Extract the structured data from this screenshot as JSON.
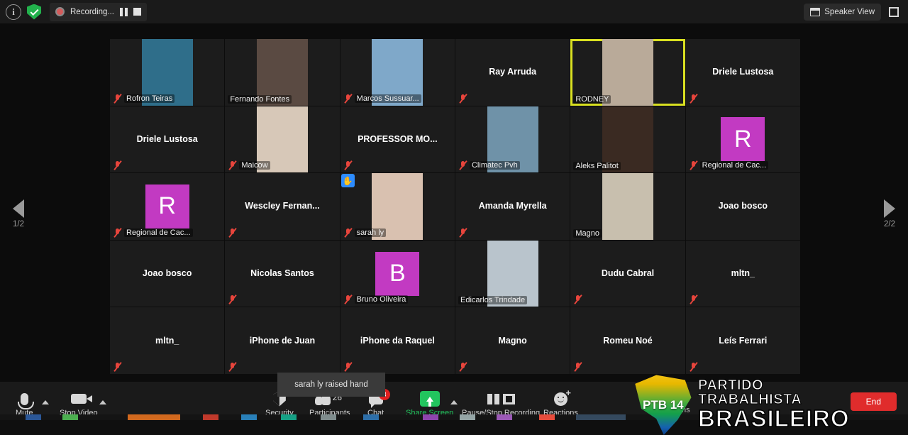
{
  "topbar": {
    "info_icon": "info-icon",
    "encryption_icon": "shield-check-icon",
    "recording_label": "Recording...",
    "pause_icon": "pause-icon",
    "stop_icon": "stop-icon",
    "speaker_view_label": "Speaker View",
    "fullscreen_icon": "fullscreen-icon"
  },
  "gallery": {
    "page_prev_label": "1/2",
    "page_next_label": "2/2",
    "active_participant": "RODNEY",
    "toast": "sarah ly raised hand",
    "participants": [
      {
        "name": "Rofron Teiras",
        "video": true,
        "name_position": "bottom",
        "muted": true,
        "avatar": null,
        "raised_hand": false,
        "video_bg": "#2f6e8a"
      },
      {
        "name": "Fernando Fontes",
        "video": true,
        "name_position": "bottom",
        "muted": false,
        "avatar": null,
        "raised_hand": false,
        "video_bg": "#5a4a42"
      },
      {
        "name": "Marcos Sussuar...",
        "video": true,
        "name_position": "bottom",
        "muted": true,
        "avatar": null,
        "raised_hand": false,
        "video_bg": "#7fa8c9"
      },
      {
        "name": "Ray Arruda",
        "video": false,
        "name_position": "center",
        "muted": true,
        "avatar": null,
        "raised_hand": false,
        "video_bg": null
      },
      {
        "name": "RODNEY",
        "video": true,
        "name_position": "bottom",
        "muted": false,
        "avatar": null,
        "raised_hand": false,
        "video_bg": "#b9aa99",
        "active": true
      },
      {
        "name": "Driele Lustosa",
        "video": false,
        "name_position": "center",
        "muted": true,
        "avatar": null,
        "raised_hand": false,
        "video_bg": null
      },
      {
        "name": "Driele Lustosa",
        "video": false,
        "name_position": "center",
        "muted": true,
        "avatar": null,
        "raised_hand": false,
        "video_bg": null
      },
      {
        "name": "Maicow",
        "video": true,
        "name_position": "bottom",
        "muted": true,
        "avatar": null,
        "raised_hand": false,
        "video_bg": "#d7c8b8"
      },
      {
        "name": "PROFESSOR  MO...",
        "video": false,
        "name_position": "center",
        "muted": true,
        "avatar": null,
        "raised_hand": false,
        "video_bg": null
      },
      {
        "name": "Climatec Pvh",
        "video": true,
        "name_position": "bottom",
        "muted": true,
        "avatar": null,
        "raised_hand": false,
        "video_bg": "#6f92a8"
      },
      {
        "name": "Aleks Palitot",
        "video": true,
        "name_position": "bottom",
        "muted": false,
        "avatar": null,
        "raised_hand": false,
        "video_bg": "#3a2a22"
      },
      {
        "name": "Regional de Cac...",
        "video": false,
        "name_position": "bottom",
        "muted": true,
        "avatar": "R",
        "raised_hand": false,
        "video_bg": null
      },
      {
        "name": "Regional de Cac...",
        "video": false,
        "name_position": "bottom",
        "muted": true,
        "avatar": "R",
        "raised_hand": false,
        "video_bg": null
      },
      {
        "name": "Wescley  Fernan...",
        "video": false,
        "name_position": "center",
        "muted": true,
        "avatar": null,
        "raised_hand": false,
        "video_bg": null
      },
      {
        "name": "sarah ly",
        "video": true,
        "name_position": "bottom",
        "muted": true,
        "avatar": null,
        "raised_hand": true,
        "video_bg": "#d9c1b0"
      },
      {
        "name": "Amanda Myrella",
        "video": false,
        "name_position": "center",
        "muted": true,
        "avatar": null,
        "raised_hand": false,
        "video_bg": null
      },
      {
        "name": "Magno",
        "video": true,
        "name_position": "bottom",
        "muted": false,
        "avatar": null,
        "raised_hand": false,
        "video_bg": "#c8bfae"
      },
      {
        "name": "Joao bosco",
        "video": false,
        "name_position": "center",
        "muted": false,
        "avatar": null,
        "raised_hand": false,
        "video_bg": null
      },
      {
        "name": "Joao bosco",
        "video": false,
        "name_position": "center",
        "muted": false,
        "avatar": null,
        "raised_hand": false,
        "video_bg": null
      },
      {
        "name": "Nicolas Santos",
        "video": false,
        "name_position": "center",
        "muted": true,
        "avatar": null,
        "raised_hand": false,
        "video_bg": null
      },
      {
        "name": "Bruno Oliveira",
        "video": false,
        "name_position": "bottom",
        "muted": true,
        "avatar": "B",
        "raised_hand": false,
        "video_bg": null
      },
      {
        "name": "Edicarlos Trindade",
        "video": true,
        "name_position": "bottom",
        "muted": false,
        "avatar": null,
        "raised_hand": false,
        "video_bg": "#b9c4cc"
      },
      {
        "name": "Dudu Cabral",
        "video": false,
        "name_position": "center",
        "muted": true,
        "avatar": null,
        "raised_hand": false,
        "video_bg": null
      },
      {
        "name": "mltn_",
        "video": false,
        "name_position": "center",
        "muted": true,
        "avatar": null,
        "raised_hand": false,
        "video_bg": null
      },
      {
        "name": "mltn_",
        "video": false,
        "name_position": "center",
        "muted": true,
        "avatar": null,
        "raised_hand": false,
        "video_bg": null
      },
      {
        "name": "iPhone de Juan",
        "video": false,
        "name_position": "center",
        "muted": true,
        "avatar": null,
        "raised_hand": false,
        "video_bg": null
      },
      {
        "name": "iPhone da Raquel",
        "video": false,
        "name_position": "center",
        "muted": true,
        "avatar": null,
        "raised_hand": false,
        "video_bg": null
      },
      {
        "name": "Magno",
        "video": false,
        "name_position": "center",
        "muted": true,
        "avatar": null,
        "raised_hand": false,
        "video_bg": null
      },
      {
        "name": "Romeu Noé",
        "video": false,
        "name_position": "center",
        "muted": true,
        "avatar": null,
        "raised_hand": false,
        "video_bg": null
      },
      {
        "name": "Leís Ferrari",
        "video": false,
        "name_position": "center",
        "muted": true,
        "avatar": null,
        "raised_hand": false,
        "video_bg": null
      }
    ]
  },
  "overlay_logo": {
    "badge_text": "PTB 14",
    "line1": "PARTIDO TRABALHISTA",
    "line2": "BRASILEIRO"
  },
  "bottombar": {
    "mute_label": "Mute",
    "stop_video_label": "Stop Video",
    "security_label": "Security",
    "participants_label": "Participants",
    "participants_count": "26",
    "chat_label": "Chat",
    "chat_badge": "3",
    "share_screen_label": "Share Screen",
    "pause_stop_recording_label": "Pause/Stop Recording",
    "reactions_label": "Reactions",
    "partial_label": "ns",
    "end_label": "End"
  },
  "colors": {
    "accent_green": "#22c55e",
    "active_border": "#d9e021",
    "end_red": "#e02c2c",
    "avatar_purple": "#c23ac2",
    "badge_red": "#e02020",
    "raise_hand_blue": "#2d8cff"
  }
}
